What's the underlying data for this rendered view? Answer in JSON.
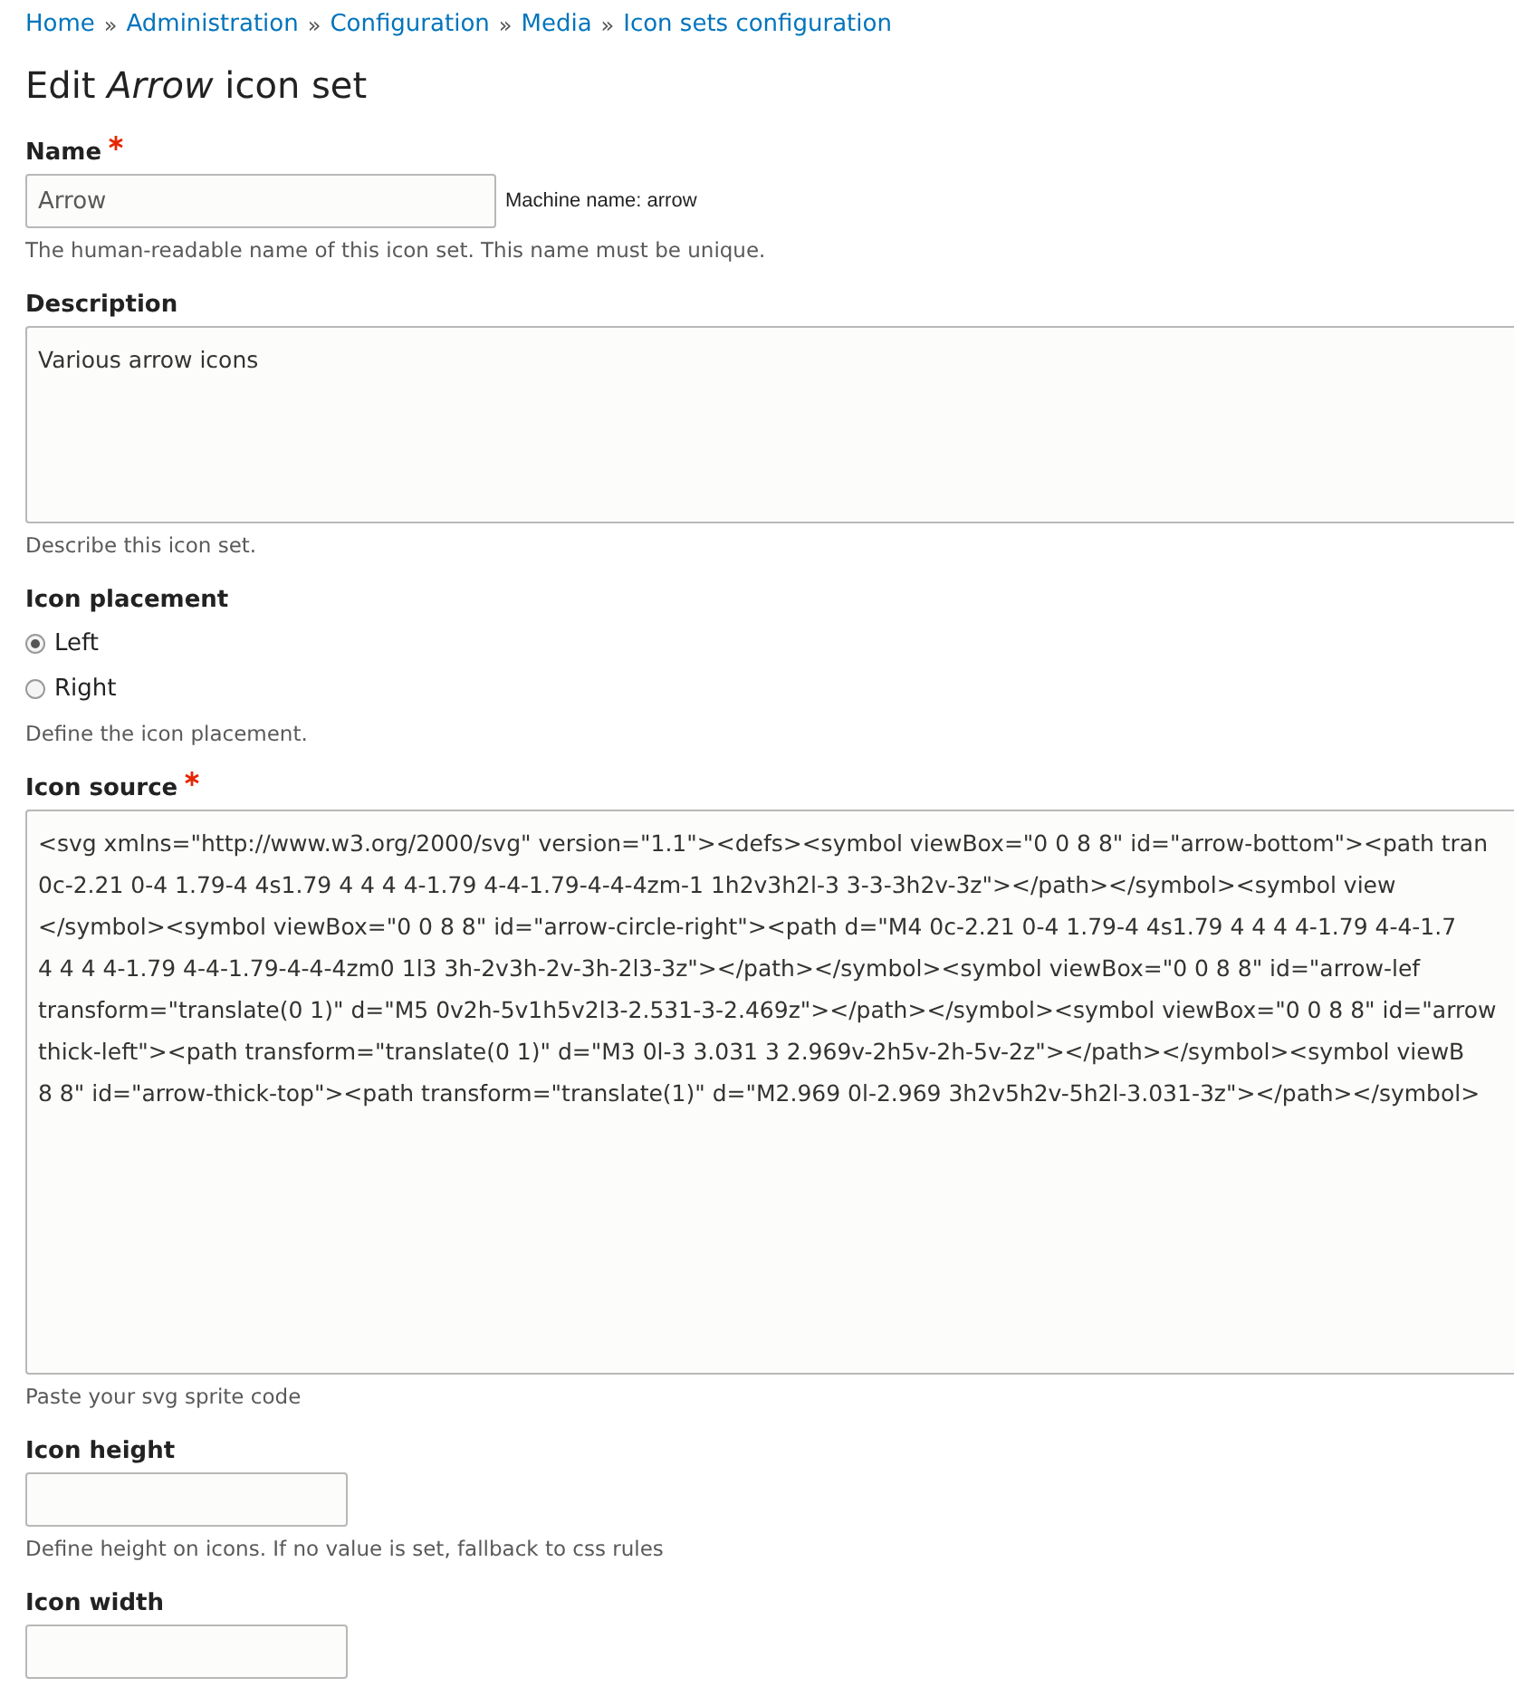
{
  "breadcrumb": [
    "Home",
    "Administration",
    "Configuration",
    "Media",
    "Icon sets configuration"
  ],
  "breadcrumb_separator": "»",
  "title": "Edit *Arrow* icon set",
  "name_field": {
    "label": "Name",
    "required": true,
    "value": "Arrow",
    "machine_name": "Machine name: arrow",
    "description": "The human-readable name of this icon set. This name must be unique."
  },
  "description_field": {
    "label": "Description",
    "value": "Various arrow icons",
    "description": "Describe this icon set."
  },
  "icon_placement": {
    "label": "Icon placement",
    "options": [
      {
        "label": "Left",
        "selected": true
      },
      {
        "label": "Right",
        "selected": false
      }
    ],
    "description": "Define the icon placement."
  },
  "icon_source": {
    "label": "Icon source",
    "required": true,
    "lines": [
      "<svg xmlns=\"http://www.w3.org/2000/svg\" version=\"1.1\"><defs><symbol viewBox=\"0 0 8 8\" id=\"arrow-bottom\"><path tran",
      "0c-2.21 0-4 1.79-4 4s1.79 4 4 4 4-1.79 4-4-1.79-4-4-4zm-1 1h2v3h2l-3 3-3-3h2v-3z\"></path></symbol><symbol view",
      "</symbol><symbol viewBox=\"0 0 8 8\" id=\"arrow-circle-right\"><path d=\"M4 0c-2.21 0-4 1.79-4 4s1.79 4 4 4 4-1.79 4-4-1.7",
      "4 4 4 4-1.79 4-4-1.79-4-4-4zm0 1l3 3h-2v3h-2v-3h-2l3-3z\"></path></symbol><symbol viewBox=\"0 0 8 8\" id=\"arrow-lef",
      "transform=\"translate(0 1)\" d=\"M5 0v2h-5v1h5v2l3-2.531-3-2.469z\"></path></symbol><symbol viewBox=\"0 0 8 8\" id=\"arrow",
      "thick-left\"><path transform=\"translate(0 1)\" d=\"M3 0l-3 3.031 3 2.969v-2h5v-2h-5v-2z\"></path></symbol><symbol viewB",
      "8 8\" id=\"arrow-thick-top\"><path transform=\"translate(1)\" d=\"M2.969 0l-2.969 3h2v5h2v-5h2l-3.031-3z\"></path></symbol>"
    ],
    "description": "Paste your svg sprite code"
  },
  "icon_height": {
    "label": "Icon height",
    "description": "Define height on icons. If no value is set, fallback to css rules"
  },
  "icon_width": {
    "label": "Icon width"
  }
}
